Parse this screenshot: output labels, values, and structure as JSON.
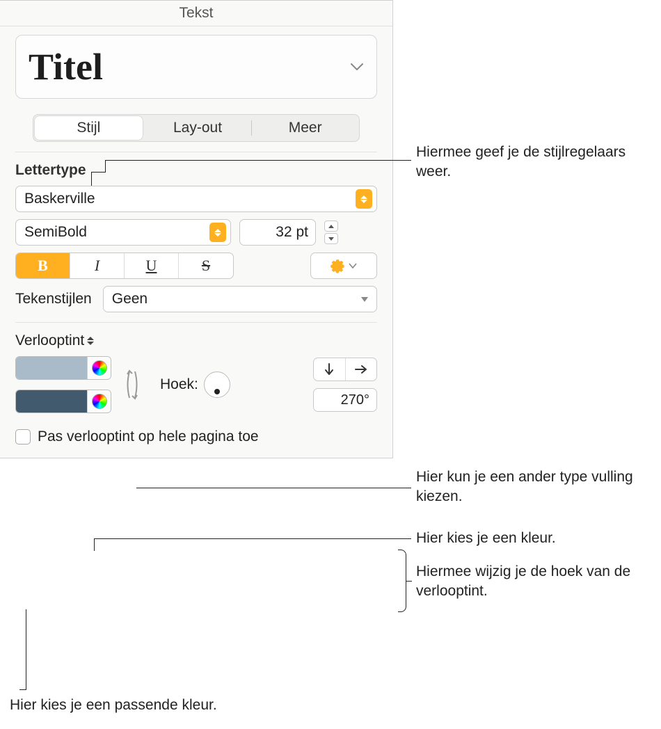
{
  "panel": {
    "title": "Tekst",
    "style_name": "Titel"
  },
  "tabs": {
    "stijl": "Stijl",
    "layout": "Lay-out",
    "meer": "Meer"
  },
  "font": {
    "section_label": "Lettertype",
    "family": "Baskerville",
    "weight": "SemiBold",
    "size": "32 pt",
    "bold": "B",
    "italic": "I",
    "underline": "U",
    "strike": "S"
  },
  "char_styles": {
    "label": "Tekenstijlen",
    "value": "Geen"
  },
  "fill": {
    "type_label": "Verlooptint",
    "angle_label": "Hoek:",
    "angle_value": "270°",
    "color1": "#a9bbc8",
    "color2": "#425a6e",
    "apply_whole_page": "Pas verlooptint op hele pagina toe"
  },
  "callouts": {
    "stijl_tab": "Hiermee geef je de stijlregelaars weer.",
    "fill_type": "Hier kun je een ander type vulling kiezen.",
    "color_pick": "Hier kies je een kleur.",
    "angle_change": "Hiermee wijzig je de hoek van de verlooptint.",
    "matching_color": "Hier kies je een passende kleur."
  }
}
